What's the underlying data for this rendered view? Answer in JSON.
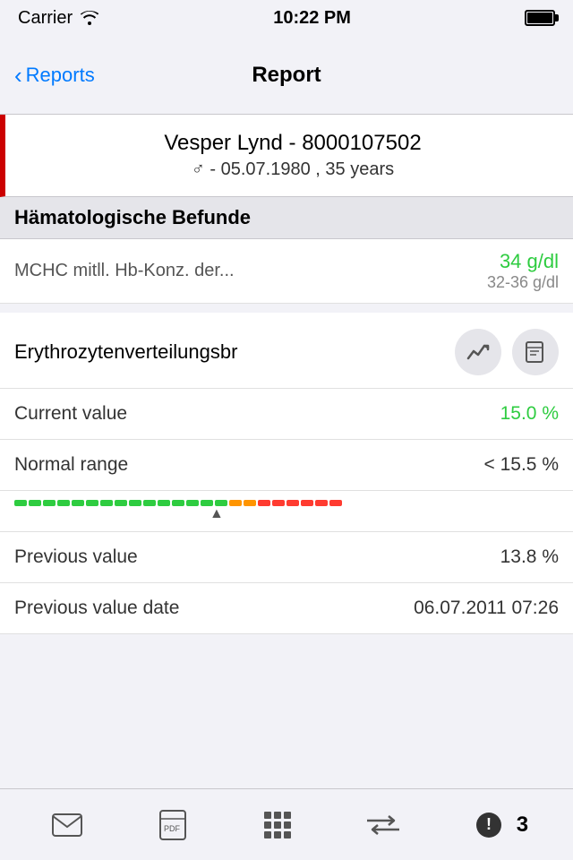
{
  "statusBar": {
    "carrier": "Carrier",
    "time": "10:22 PM"
  },
  "navBar": {
    "backLabel": "Reports",
    "title": "Report"
  },
  "patient": {
    "name": "Vesper Lynd - 8000107502",
    "gender": "♂",
    "dob": "05.07.1980",
    "age": "35 years"
  },
  "sectionTitle": "Hämatologische Befunde",
  "mchcRow": {
    "label": "MCHC mitll. Hb-Konz. der...",
    "value": "34 g/dl",
    "range": "32-36 g/dl"
  },
  "detail": {
    "title": "Erythrozytenverteilungsbr",
    "currentValueLabel": "Current value",
    "currentValue": "15.0 %",
    "normalRangeLabel": "Normal range",
    "normalRange": "< 15.5 %",
    "previousValueLabel": "Previous value",
    "previousValue": "13.8 %",
    "previousDateLabel": "Previous value date",
    "previousDate": "06.07.2011 07:26",
    "indicatorOffset": "73",
    "greenDashes": 15,
    "orangeDashes": 2,
    "redDashes": 6
  },
  "toolbar": {
    "mailIcon": "✉",
    "pdfIcon": "pdf",
    "gridIcon": "grid",
    "transferIcon": "⇌",
    "alertIcon": "alert",
    "alertCount": "3"
  }
}
